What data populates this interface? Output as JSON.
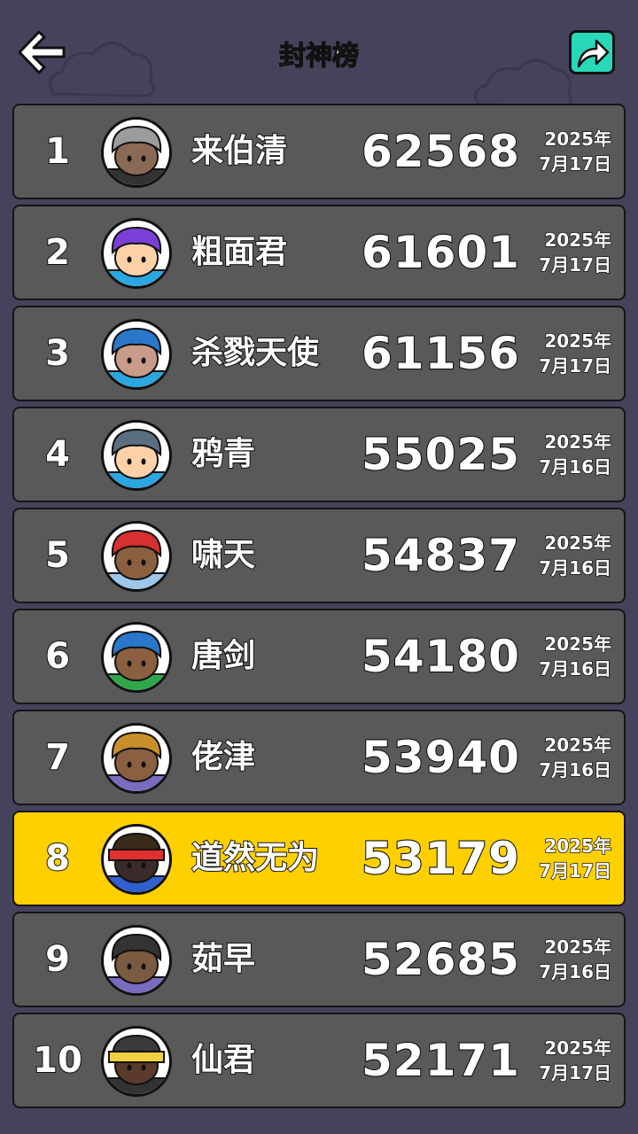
{
  "header": {
    "title": "封神榜",
    "back_icon": "back-arrow-icon",
    "share_icon": "share-icon",
    "share_color": "#28d8b8"
  },
  "colors": {
    "background": "#45435c",
    "row": "#595959",
    "highlight_row": "#ffd000"
  },
  "leaderboard": [
    {
      "rank": "1",
      "name": "来伯清",
      "score": "62568",
      "year": "2025年",
      "day": "7月17日",
      "avatar": {
        "hair": "#9c9c9c",
        "skin": "#8a6a55",
        "shirt": "#333333"
      },
      "current": false
    },
    {
      "rank": "2",
      "name": "粗面君",
      "score": "61601",
      "year": "2025年",
      "day": "7月17日",
      "avatar": {
        "hair": "#7a3fd6",
        "skin": "#ffd1a8",
        "shirt": "#2aa7e0"
      },
      "current": false
    },
    {
      "rank": "3",
      "name": "杀戮天使",
      "score": "61156",
      "year": "2025年",
      "day": "7月17日",
      "avatar": {
        "hair": "#2a77c9",
        "skin": "#c99b8a",
        "shirt": "#2aa7e0"
      },
      "current": false
    },
    {
      "rank": "4",
      "name": "鸦青",
      "score": "55025",
      "year": "2025年",
      "day": "7月16日",
      "avatar": {
        "hair": "#5a6e80",
        "skin": "#ffd1a8",
        "shirt": "#2aa7e0"
      },
      "current": false
    },
    {
      "rank": "5",
      "name": "啸天",
      "score": "54837",
      "year": "2025年",
      "day": "7月16日",
      "avatar": {
        "hair": "#d63030",
        "skin": "#8a6040",
        "shirt": "#9ec8ea"
      },
      "current": false
    },
    {
      "rank": "6",
      "name": "唐剑",
      "score": "54180",
      "year": "2025年",
      "day": "7月16日",
      "avatar": {
        "hair": "#2a77c9",
        "skin": "#8a6040",
        "shirt": "#2ea84a"
      },
      "current": false
    },
    {
      "rank": "7",
      "name": "佬津",
      "score": "53940",
      "year": "2025年",
      "day": "7月16日",
      "avatar": {
        "hair": "#c8902a",
        "skin": "#8a6040",
        "shirt": "#7a6ac0"
      },
      "current": false
    },
    {
      "rank": "8",
      "name": "道然无为",
      "score": "53179",
      "year": "2025年",
      "day": "7月17日",
      "avatar": {
        "hair": "#3a2a1a",
        "skin": "#3a2a2a",
        "shirt": "#3060d0",
        "band": "#e03030"
      },
      "current": true
    },
    {
      "rank": "9",
      "name": "茹早",
      "score": "52685",
      "year": "2025年",
      "day": "7月16日",
      "avatar": {
        "hair": "#333333",
        "skin": "#7a5a40",
        "shirt": "#7a6ac0"
      },
      "current": false
    },
    {
      "rank": "10",
      "name": "仙君",
      "score": "52171",
      "year": "2025年",
      "day": "7月17日",
      "avatar": {
        "hair": "#3a3a3a",
        "skin": "#5a3a2a",
        "shirt": "#333333",
        "band": "#f0d040"
      },
      "current": false
    }
  ]
}
